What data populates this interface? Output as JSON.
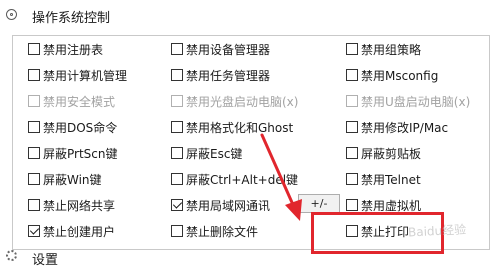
{
  "header": {
    "title": "操作系统控制",
    "icon": "gear-icon"
  },
  "options": [
    {
      "label": "禁用注册表",
      "checked": false,
      "disabled": false
    },
    {
      "label": "禁用设备管理器",
      "checked": false,
      "disabled": false
    },
    {
      "label": "禁用组策略",
      "checked": false,
      "disabled": false
    },
    {
      "label": "禁用计算机管理",
      "checked": false,
      "disabled": false
    },
    {
      "label": "禁用任务管理器",
      "checked": false,
      "disabled": false
    },
    {
      "label": "禁用Msconfig",
      "checked": false,
      "disabled": false
    },
    {
      "label": "禁用安全模式",
      "checked": false,
      "disabled": true
    },
    {
      "label": "禁用光盘启动电脑(x)",
      "checked": false,
      "disabled": true
    },
    {
      "label": "禁用U盘启动电脑(x)",
      "checked": false,
      "disabled": true
    },
    {
      "label": "禁用DOS命令",
      "checked": false,
      "disabled": false
    },
    {
      "label": "禁用格式化和Ghost",
      "checked": false,
      "disabled": false
    },
    {
      "label": "禁用修改IP/Mac",
      "checked": false,
      "disabled": false
    },
    {
      "label": "屏蔽PrtScn键",
      "checked": false,
      "disabled": false
    },
    {
      "label": "屏蔽Esc键",
      "checked": false,
      "disabled": false
    },
    {
      "label": "屏蔽剪贴板",
      "checked": false,
      "disabled": false
    },
    {
      "label": "屏蔽Win键",
      "checked": false,
      "disabled": false
    },
    {
      "label": "屏蔽Ctrl+Alt+del键",
      "checked": false,
      "disabled": false
    },
    {
      "label": "禁用Telnet",
      "checked": false,
      "disabled": false
    },
    {
      "label": "禁止网络共享",
      "checked": false,
      "disabled": false
    },
    {
      "label": "禁用局域网通讯",
      "checked": true,
      "disabled": false
    },
    {
      "label": "禁用虚拟机",
      "checked": false,
      "disabled": false
    },
    {
      "label": "禁止创建用户",
      "checked": true,
      "disabled": false
    },
    {
      "label": "禁止删除文件",
      "checked": false,
      "disabled": false
    },
    {
      "label": "禁止打印",
      "checked": false,
      "disabled": false
    }
  ],
  "plus_minus_button": {
    "label": "+/-"
  },
  "footer": {
    "label": "设置",
    "icon": "settings-icon"
  },
  "annotations": {
    "highlight_color": "#e1262d",
    "watermark": "Baidu经验"
  }
}
